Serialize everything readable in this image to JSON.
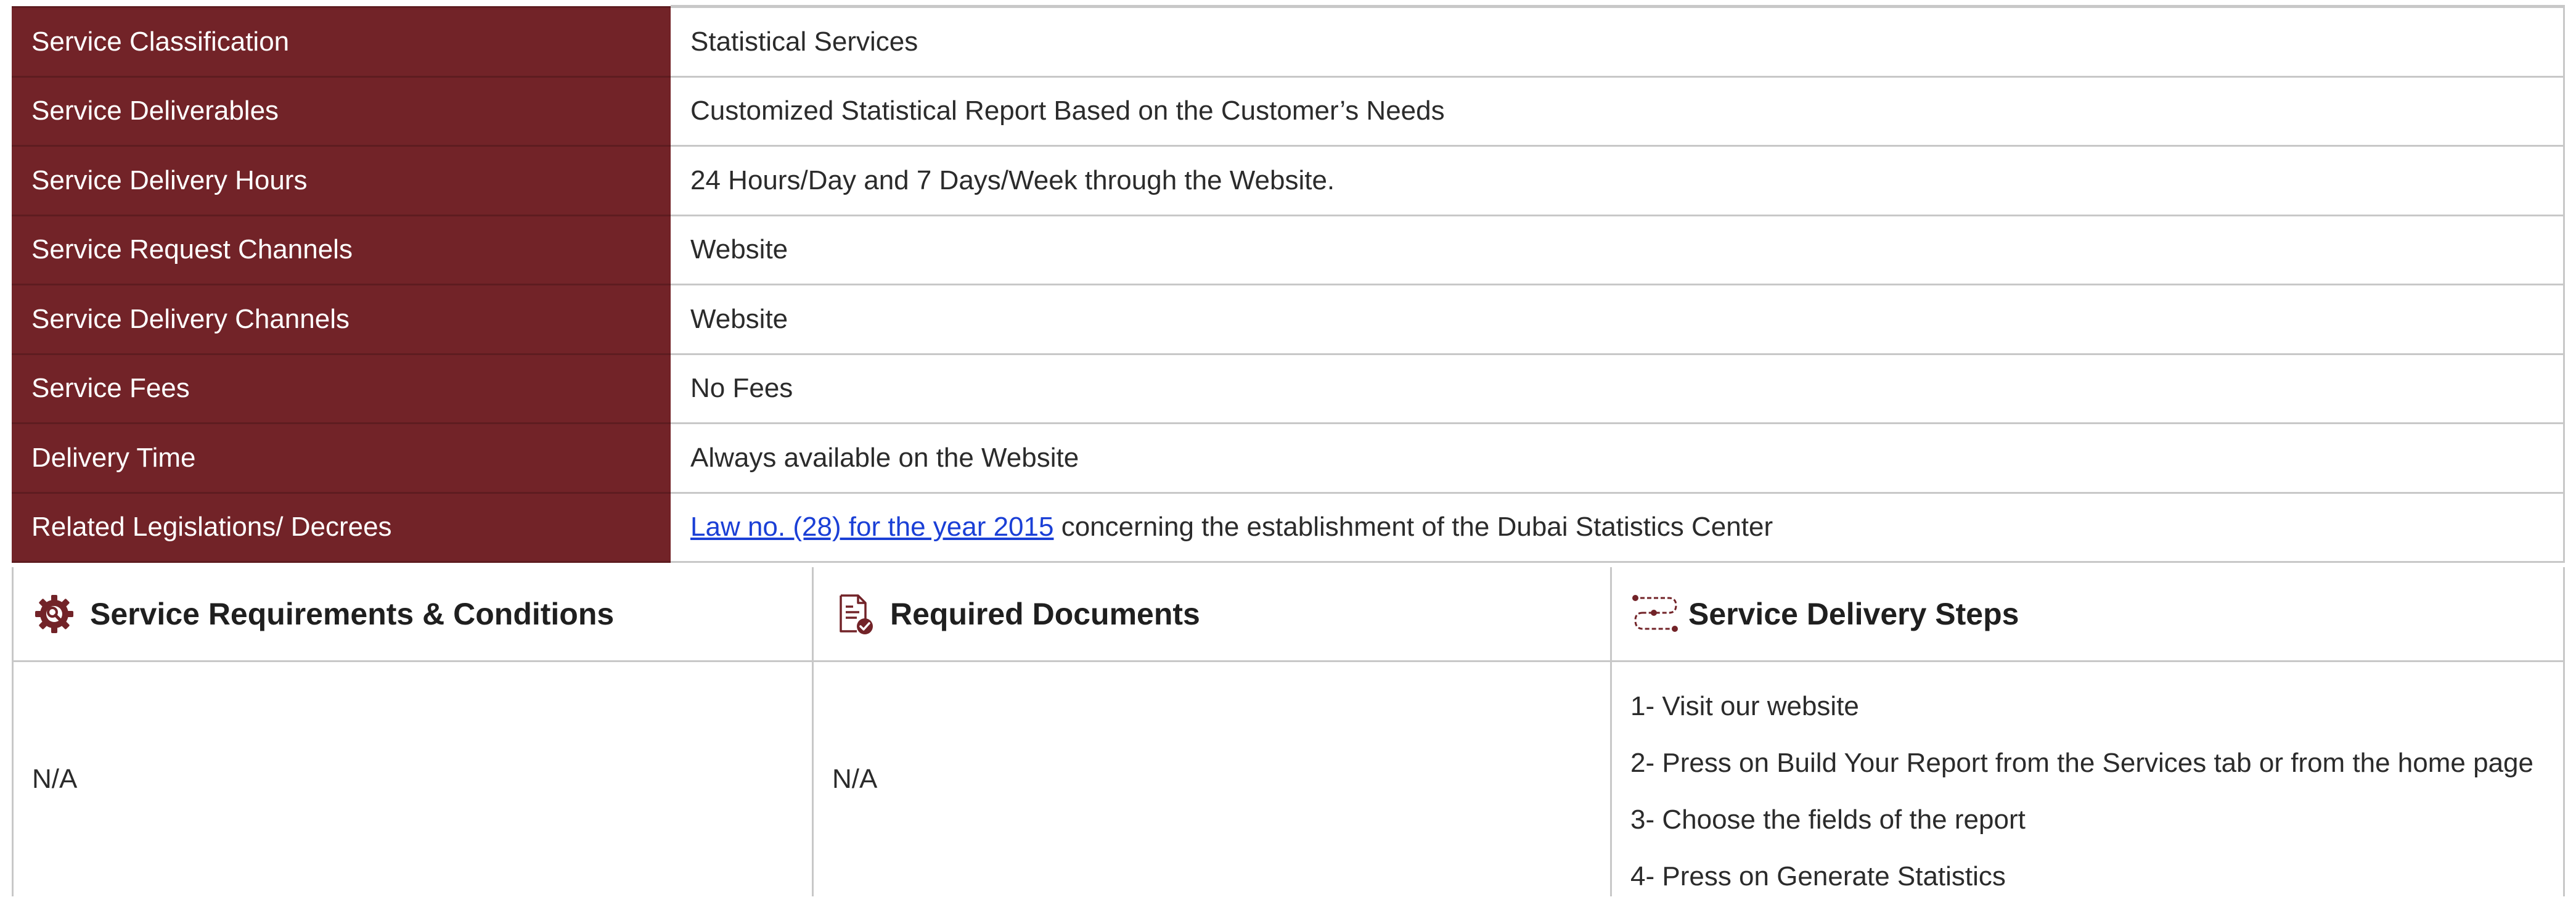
{
  "info_rows": [
    {
      "label": "Service Classification",
      "value": "Statistical Services"
    },
    {
      "label": "Service Deliverables",
      "value": "Customized Statistical Report Based on the Customer’s Needs"
    },
    {
      "label": "Service Delivery Hours",
      "value": "24 Hours/Day and 7 Days/Week through the Website."
    },
    {
      "label": "Service Request Channels",
      "value": "Website"
    },
    {
      "label": "Service Delivery Channels",
      "value": "Website"
    },
    {
      "label": "Service Fees",
      "value": "No Fees"
    },
    {
      "label": "Delivery Time",
      "value": "Always available on the Website"
    },
    {
      "label": "Related Legislations/ Decrees",
      "link_text": "Law no. (28) for the year 2015",
      "value_suffix": " concerning the establishment of the Dubai Statistics Center"
    }
  ],
  "sections": {
    "requirements": {
      "title": "Service Requirements & Conditions",
      "icon": "gear-icon",
      "body": "N/A"
    },
    "documents": {
      "title": "Required Documents",
      "icon": "document-check-icon",
      "body": "N/A"
    },
    "steps": {
      "title": "Service Delivery Steps",
      "icon": "steps-path-icon",
      "items": [
        "1- Visit our website",
        "2- Press on Build Your Report from the Services tab or from the home page",
        "3- Choose the fields of the report",
        "4- Press on Generate Statistics"
      ]
    }
  },
  "colors": {
    "label_background": "#722328",
    "accent": "#722328",
    "link": "#1a3fd6",
    "border": "#c8c8c8"
  }
}
